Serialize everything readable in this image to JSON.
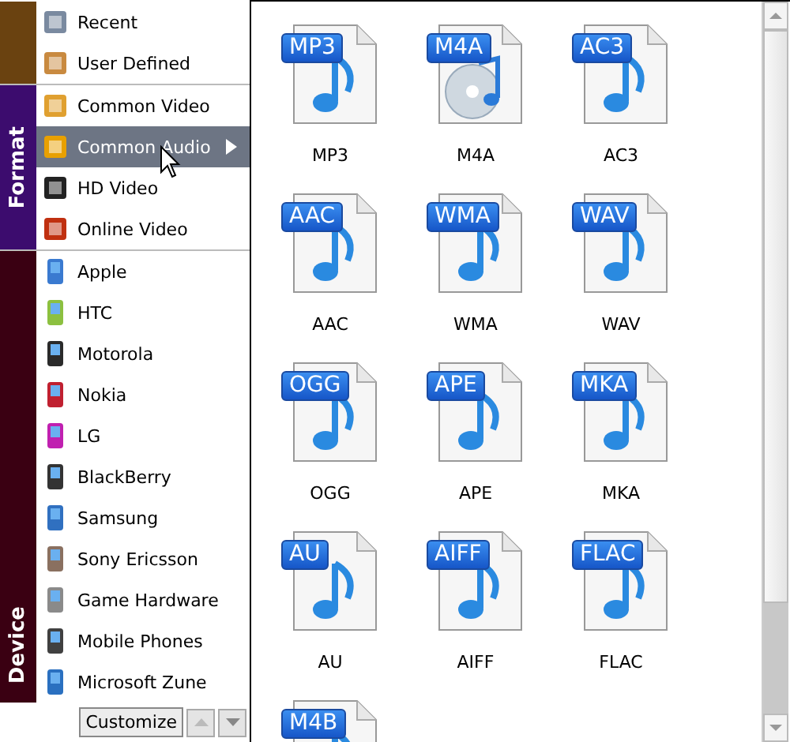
{
  "sidebar": {
    "sections": [
      {
        "color": "#6a4210",
        "items": [
          {
            "label": "Recent",
            "selected": false
          },
          {
            "label": "User Defined",
            "selected": false
          }
        ]
      },
      {
        "label": "Format",
        "color": "#3c0c6e",
        "items": [
          {
            "label": "Common Video",
            "selected": false
          },
          {
            "label": "Common Audio",
            "selected": true,
            "submenu": true
          },
          {
            "label": "HD Video",
            "selected": false
          },
          {
            "label": "Online Video",
            "selected": false
          }
        ]
      },
      {
        "label": "Device",
        "color": "#3a0012",
        "items": [
          {
            "label": "Apple",
            "selected": false
          },
          {
            "label": "HTC",
            "selected": false
          },
          {
            "label": "Motorola",
            "selected": false
          },
          {
            "label": "Nokia",
            "selected": false
          },
          {
            "label": "LG",
            "selected": false
          },
          {
            "label": "BlackBerry",
            "selected": false
          },
          {
            "label": "Samsung",
            "selected": false
          },
          {
            "label": "Sony Ericsson",
            "selected": false
          },
          {
            "label": "Game Hardware",
            "selected": false
          },
          {
            "label": "Mobile Phones",
            "selected": false
          },
          {
            "label": "Microsoft Zune",
            "selected": false
          }
        ]
      }
    ],
    "customize_button": "Customize"
  },
  "formats": [
    {
      "badge": "MP3",
      "label": "MP3",
      "kind": "note"
    },
    {
      "badge": "M4A",
      "label": "M4A",
      "kind": "disc"
    },
    {
      "badge": "AC3",
      "label": "AC3",
      "kind": "note"
    },
    {
      "badge": "AAC",
      "label": "AAC",
      "kind": "note"
    },
    {
      "badge": "WMA",
      "label": "WMA",
      "kind": "note"
    },
    {
      "badge": "WAV",
      "label": "WAV",
      "kind": "note"
    },
    {
      "badge": "OGG",
      "label": "OGG",
      "kind": "note"
    },
    {
      "badge": "APE",
      "label": "APE",
      "kind": "note"
    },
    {
      "badge": "MKA",
      "label": "MKA",
      "kind": "note"
    },
    {
      "badge": "AU",
      "label": "AU",
      "kind": "note"
    },
    {
      "badge": "AIFF",
      "label": "AIFF",
      "kind": "note"
    },
    {
      "badge": "FLAC",
      "label": "FLAC",
      "kind": "note"
    },
    {
      "badge": "M4B",
      "kind": "note"
    }
  ]
}
